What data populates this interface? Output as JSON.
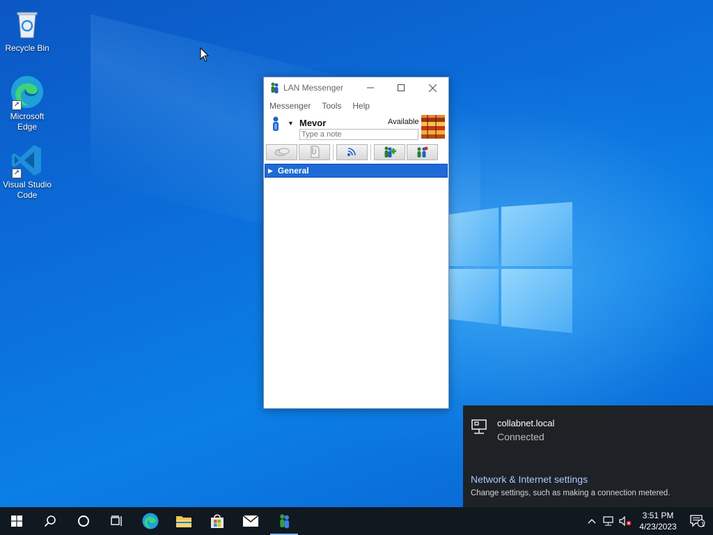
{
  "desktop": {
    "icons": [
      {
        "label": "Recycle Bin"
      },
      {
        "label": "Microsoft Edge"
      },
      {
        "label": "Visual Studio Code"
      }
    ]
  },
  "lan_messenger": {
    "title": "LAN Messenger",
    "menu": [
      "Messenger",
      "Tools",
      "Help"
    ],
    "user_name": "Mevor",
    "status": "Available",
    "note_placeholder": "Type a note",
    "toolbar_icons": [
      "chat-icon",
      "file-transfer-icon",
      "broadcast-icon",
      "add-contact-icon",
      "group-icon"
    ],
    "group": "General",
    "colors": {
      "group_header": "#1e6ad6"
    }
  },
  "network_flyout": {
    "network_name": "collabnet.local",
    "network_state": "Connected",
    "settings_link": "Network & Internet settings",
    "settings_desc": "Change settings, such as making a connection metered."
  },
  "taskbar": {
    "time": "3:51 PM",
    "date": "4/23/2023",
    "notification_count": "1"
  }
}
